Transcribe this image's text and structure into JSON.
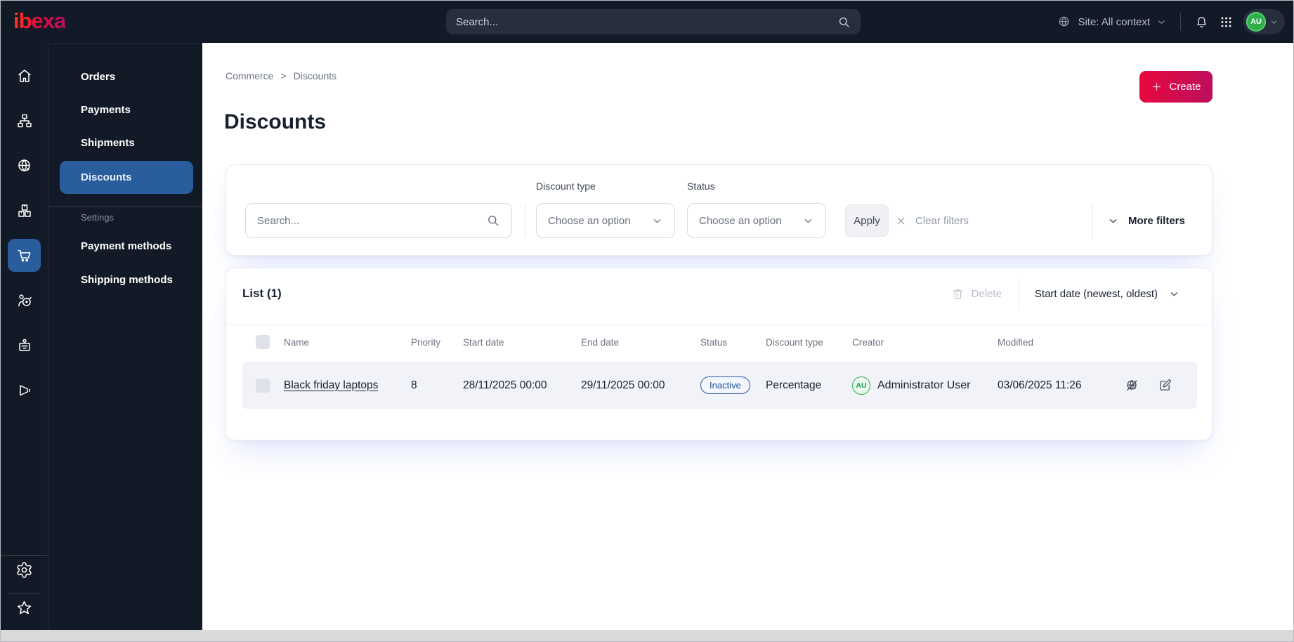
{
  "topbar": {
    "logo": "ibexa",
    "search_placeholder": "Search...",
    "site_context": "Site: All context",
    "avatar_initials": "AU"
  },
  "sidebar": {
    "menu_items": [
      {
        "label": "Orders"
      },
      {
        "label": "Payments"
      },
      {
        "label": "Shipments"
      },
      {
        "label": "Discounts"
      }
    ],
    "active_item": "Discounts",
    "settings_label": "Settings",
    "settings_items": [
      {
        "label": "Payment methods"
      },
      {
        "label": "Shipping methods"
      }
    ]
  },
  "breadcrumb": {
    "items": [
      "Commerce",
      "Discounts"
    ],
    "separator": ">"
  },
  "page": {
    "title": "Discounts",
    "create_label": "Create"
  },
  "filters": {
    "search_placeholder": "Search...",
    "discount_type_label": "Discount type",
    "discount_type_value": "Choose an option",
    "status_label": "Status",
    "status_value": "Choose an option",
    "apply_label": "Apply",
    "clear_label": "Clear filters",
    "more_filters_label": "More filters"
  },
  "list": {
    "title": "List (1)",
    "delete_label": "Delete",
    "sort_label": "Start date (newest, oldest)",
    "columns": [
      "Name",
      "Priority",
      "Start date",
      "End date",
      "Status",
      "Discount type",
      "Creator",
      "Modified"
    ],
    "rows": [
      {
        "name": "Black friday laptops",
        "priority": "8",
        "start_date": "28/11/2025 00:00",
        "end_date": "29/11/2025 00:00",
        "status": "Inactive",
        "discount_type": "Percentage",
        "creator_initials": "AU",
        "creator_name": "Administrator User",
        "modified": "03/06/2025 11:26"
      }
    ]
  },
  "icons": {
    "topbar": [
      "search-icon",
      "site-globe-icon",
      "chevron-down-icon",
      "bell-icon",
      "apps-grid-icon"
    ],
    "rail": [
      "home-icon",
      "sitemap-icon",
      "site-globe-cursor-icon",
      "products-boxes-icon",
      "commerce-cart-icon",
      "personalization-target-icon",
      "corporate-badge-icon",
      "marketing-megaphone-icon",
      "settings-gear-icon",
      "bookmarks-star-icon"
    ],
    "row_actions": [
      "preview-globe-slash-icon",
      "edit-icon"
    ]
  },
  "colors": {
    "topbar_bg": "#131a27",
    "active_item_blue": "#2a5d9c",
    "accent_gradient_start": "#e8083c",
    "accent_gradient_end": "#bd0f5e",
    "status_inactive_blue": "#1d4f9c",
    "avatar_green": "#2fae4b"
  }
}
